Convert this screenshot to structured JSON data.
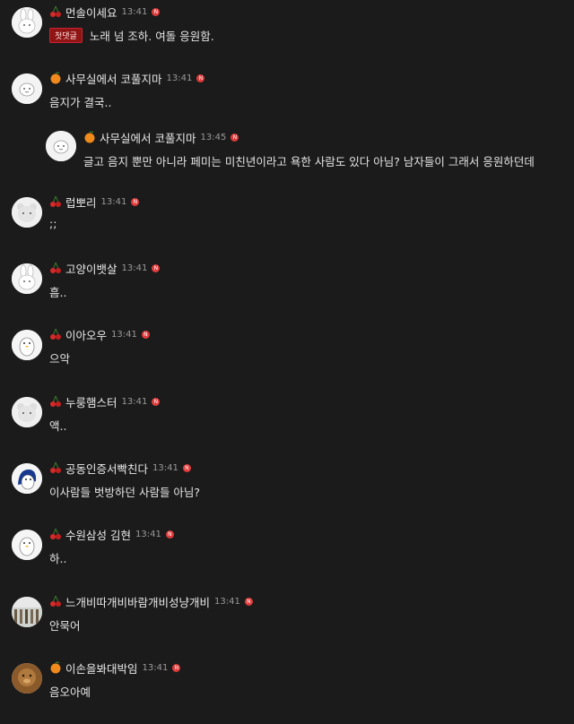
{
  "comments": [
    {
      "nick": "먼솔이세요",
      "time": "13:41",
      "icon": "cherry-icon",
      "avatar": "bunny",
      "tag": "첫댓글",
      "text": "노래 넘 조하. 여돌 응원함.",
      "reply": false
    },
    {
      "nick": "사무실에서 코풀지마",
      "time": "13:41",
      "icon": "orange-icon",
      "avatar": "seal",
      "text": "음지가 결국..",
      "reply": false
    },
    {
      "nick": "사무실에서 코풀지마",
      "time": "13:45",
      "icon": "orange-icon",
      "avatar": "seal",
      "text": "글고 음지 뿐만 아니라 페미는 미친년이라고 욕한 사람도 있다 아님? 남자들이 그래서 응원하던데",
      "reply": true
    },
    {
      "nick": "럽뽀리",
      "time": "13:41",
      "icon": "cherry-icon",
      "avatar": "bear",
      "text": ";;",
      "reply": false
    },
    {
      "nick": "고양이뱃살",
      "time": "13:41",
      "icon": "cherry-icon",
      "avatar": "bunny",
      "text": "흠..",
      "reply": false
    },
    {
      "nick": "이아오우",
      "time": "13:41",
      "icon": "cherry-icon",
      "avatar": "penguin",
      "text": "으악",
      "reply": false
    },
    {
      "nick": "누룽햄스터",
      "time": "13:41",
      "icon": "cherry-icon",
      "avatar": "bear",
      "text": "액..",
      "reply": false
    },
    {
      "nick": "공동인증서빡친다",
      "time": "13:41",
      "icon": "cherry-icon",
      "avatar": "blue-penguin",
      "text": "이사람들 벗방하던 사람들 아님?",
      "reply": false
    },
    {
      "nick": "수원삼성 김현",
      "time": "13:41",
      "icon": "cherry-icon",
      "avatar": "penguin",
      "text": "하..",
      "reply": false
    },
    {
      "nick": "느개비따개비바람개비성냥개비",
      "time": "13:41",
      "icon": "cherry-icon",
      "avatar": "photo",
      "text": "안묵어",
      "reply": false
    },
    {
      "nick": "이손을봐대박임",
      "time": "13:41",
      "icon": "orange-icon",
      "avatar": "brown",
      "text": "음오아예",
      "reply": false
    }
  ],
  "new_badge_label": "N",
  "colors": {
    "background": "#1b1b1b",
    "badge": "#e23b3b",
    "first_tag_bg": "#8f1414"
  }
}
